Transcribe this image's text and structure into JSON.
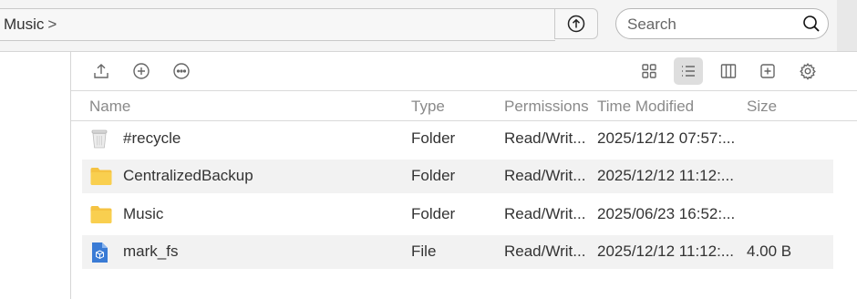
{
  "breadcrumb": {
    "current": "Music",
    "separator": ">"
  },
  "search": {
    "placeholder": "Search"
  },
  "table": {
    "columns": {
      "name": "Name",
      "type": "Type",
      "permissions": "Permissions",
      "modified": "Time Modified",
      "size": "Size"
    },
    "rows": [
      {
        "name": "#recycle",
        "type": "Folder",
        "permissions": "Read/Writ...",
        "modified": "2025/12/12 07:57:...",
        "size": "",
        "icon": "recycle-bin-icon"
      },
      {
        "name": "CentralizedBackup",
        "type": "Folder",
        "permissions": "Read/Writ...",
        "modified": "2025/12/12 11:12:...",
        "size": "",
        "icon": "folder-icon"
      },
      {
        "name": "Music",
        "type": "Folder",
        "permissions": "Read/Writ...",
        "modified": "2025/06/23 16:52:...",
        "size": "",
        "icon": "folder-icon"
      },
      {
        "name": "mark_fs",
        "type": "File",
        "permissions": "Read/Writ...",
        "modified": "2025/12/12 11:12:...",
        "size": "4.00 B",
        "icon": "file-icon"
      }
    ]
  },
  "colors": {
    "folder": "#f7c948",
    "file": "#3a7bd5",
    "active_view": "#dedede"
  }
}
